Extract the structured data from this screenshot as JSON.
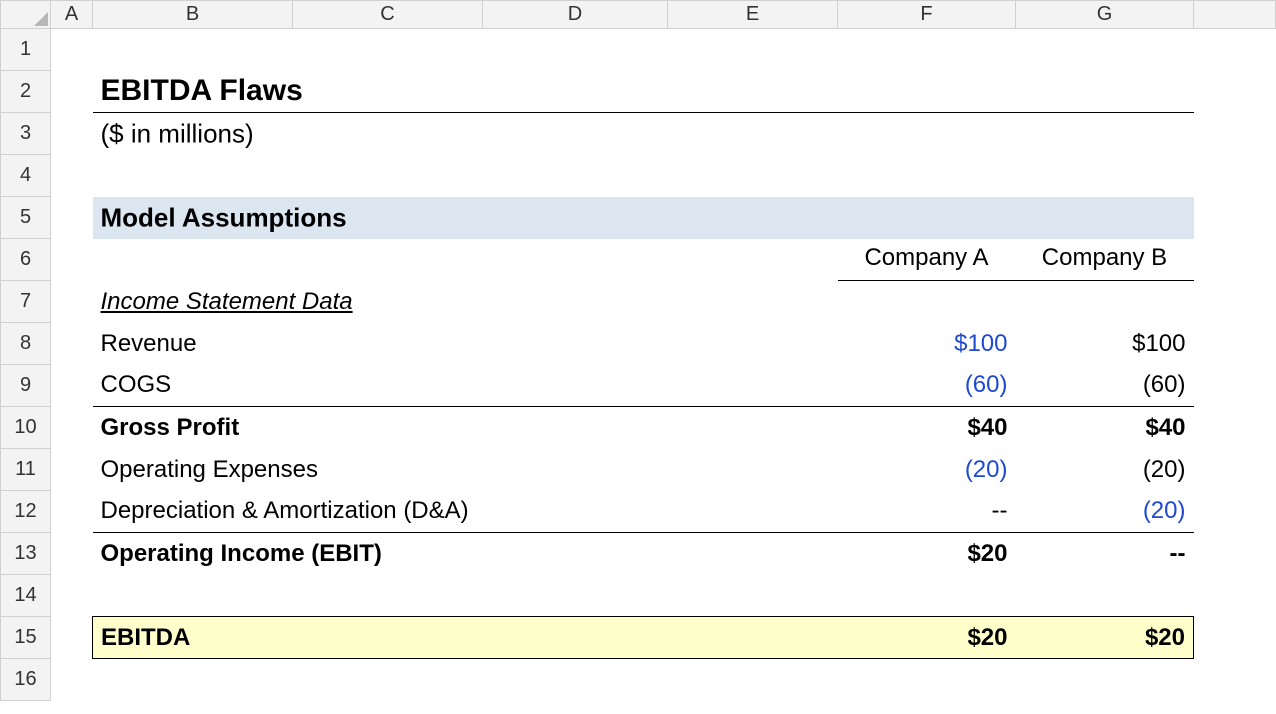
{
  "columns": [
    "A",
    "B",
    "C",
    "D",
    "E",
    "F",
    "G"
  ],
  "rows": [
    "1",
    "2",
    "3",
    "4",
    "5",
    "6",
    "7",
    "8",
    "9",
    "10",
    "11",
    "12",
    "13",
    "14",
    "15",
    "16"
  ],
  "content": {
    "title": "EBITDA Flaws",
    "subtitle": "($ in millions)",
    "section": "Model Assumptions",
    "col_hdr_F": "Company A",
    "col_hdr_G": "Company B",
    "subhead": "Income Statement Data",
    "rows": {
      "revenue": {
        "label": "Revenue",
        "F": "$100",
        "G": "$100"
      },
      "cogs": {
        "label": "COGS",
        "F": "(60)",
        "G": "(60)"
      },
      "gross": {
        "label": "Gross Profit",
        "F": "$40",
        "G": "$40"
      },
      "opex": {
        "label": "Operating Expenses",
        "F": "(20)",
        "G": "(20)"
      },
      "da": {
        "label": "Depreciation & Amortization (D&A)",
        "F": "--",
        "G": "(20)"
      },
      "ebit": {
        "label": "Operating Income (EBIT)",
        "F": "$20",
        "G": "--"
      },
      "ebitda": {
        "label": "EBITDA",
        "F": "$20",
        "G": "$20"
      }
    }
  },
  "chart_data": {
    "type": "table",
    "title": "EBITDA Flaws — Income Statement Data ($ in millions)",
    "columns": [
      "Line Item",
      "Company A",
      "Company B"
    ],
    "rows": [
      [
        "Revenue",
        100,
        100
      ],
      [
        "COGS",
        -60,
        -60
      ],
      [
        "Gross Profit",
        40,
        40
      ],
      [
        "Operating Expenses",
        -20,
        -20
      ],
      [
        "Depreciation & Amortization (D&A)",
        0,
        -20
      ],
      [
        "Operating Income (EBIT)",
        20,
        0
      ],
      [
        "EBITDA",
        20,
        20
      ]
    ]
  }
}
